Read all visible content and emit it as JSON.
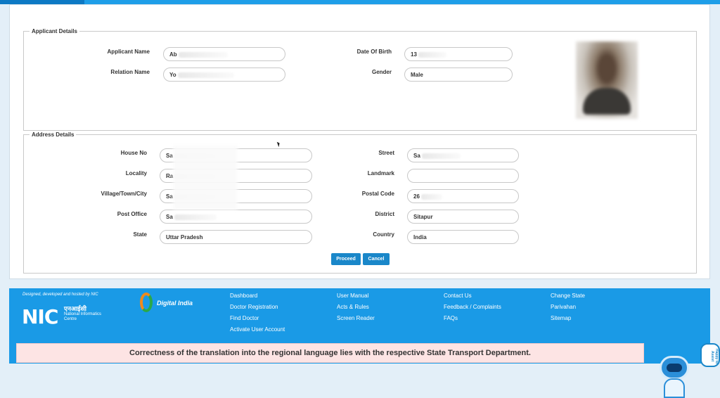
{
  "applicant": {
    "legend": "Applicant Details",
    "name_label": "Applicant Name",
    "name_value": "Ab",
    "relation_label": "Relation Name",
    "relation_value": "Yo",
    "dob_label": "Date Of Birth",
    "dob_value": "13",
    "gender_label": "Gender",
    "gender_value": "Male"
  },
  "address": {
    "legend": "Address Details",
    "house_label": "House No",
    "house_value": "Sa",
    "locality_label": "Locality",
    "locality_value": "Ra",
    "village_label": "Village/Town/City",
    "village_value": "Sa",
    "postoffice_label": "Post Office",
    "postoffice_value": "Sa",
    "state_label": "State",
    "state_value": "Uttar Pradesh",
    "street_label": "Street",
    "street_value": "Sa",
    "landmark_label": "Landmark",
    "landmark_value": "",
    "postal_label": "Postal Code",
    "postal_value": "26",
    "district_label": "District",
    "district_value": "Sitapur",
    "country_label": "Country",
    "country_value": "India"
  },
  "actions": {
    "proceed": "Proceed",
    "cancel": "Cancel"
  },
  "footer": {
    "credit": "Designed, developed and hosted by NIC",
    "nic_short": "NIC",
    "nic_hindi": "एनआईसी",
    "nic_full": "National Informatics Centre",
    "digital_india": "Digital India",
    "col1": [
      "Dashboard",
      "Doctor Registration",
      "Find Doctor",
      "Activate User Account"
    ],
    "col2": [
      "User Manual",
      "Acts & Rules",
      "Screen Reader"
    ],
    "col3": [
      "Contact Us",
      "Feedback / Complaints",
      "FAQs"
    ],
    "col4": [
      "Change State",
      "Parivahan",
      "Sitemap"
    ],
    "notice": "Correctness of the translation into the regional language lies with the respective State Transport Department."
  },
  "chatbot": {
    "bubble": "Happy to Assist"
  },
  "colors": {
    "primary": "#1a9ae6",
    "button": "#1a87c9",
    "notice_bg": "#fde4e4"
  }
}
